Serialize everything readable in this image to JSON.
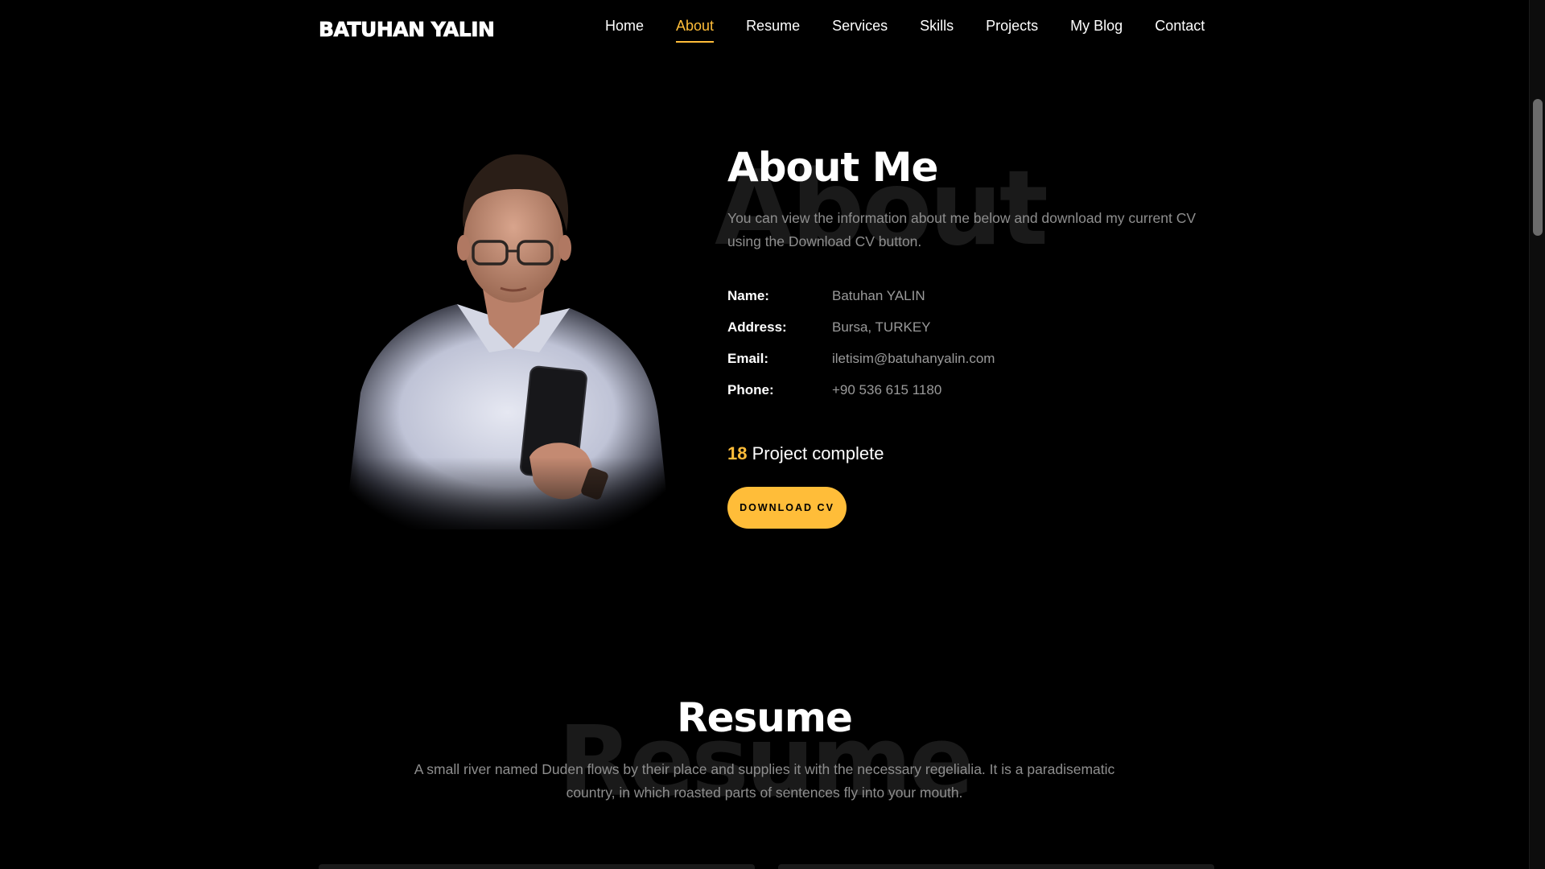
{
  "brand": "BATUHAN YALIN",
  "nav": {
    "items": [
      {
        "label": "Home",
        "active": false
      },
      {
        "label": "About",
        "active": true
      },
      {
        "label": "Resume",
        "active": false
      },
      {
        "label": "Services",
        "active": false
      },
      {
        "label": "Skills",
        "active": false
      },
      {
        "label": "Projects",
        "active": false
      },
      {
        "label": "My Blog",
        "active": false
      },
      {
        "label": "Contact",
        "active": false
      }
    ]
  },
  "about": {
    "ghost_text": "About",
    "title": "About Me",
    "description": "You can view the information about me below and download my current CV using the Download CV button.",
    "info": [
      {
        "label": "Name:",
        "value": "Batuhan YALIN"
      },
      {
        "label": "Address:",
        "value": "Bursa, TURKEY"
      },
      {
        "label": "Email:",
        "value": "iletisim@batuhanyalin.com"
      },
      {
        "label": "Phone:",
        "value": "+90 536 615 1180"
      }
    ],
    "counter_number": "18",
    "counter_text": "Project complete",
    "download_label": "DOWNLOAD CV"
  },
  "resume": {
    "ghost_text": "Resume",
    "title": "Resume",
    "description": "A small river named Duden flows by their place and supplies it with the necessary regelialia. It is a paradisematic country, in which roasted parts of sentences fly into your mouth."
  },
  "colors": {
    "accent": "#ffbd39",
    "background": "#000000",
    "muted_text": "#8e8e8e",
    "ghost_text": "#1a1a1a"
  }
}
